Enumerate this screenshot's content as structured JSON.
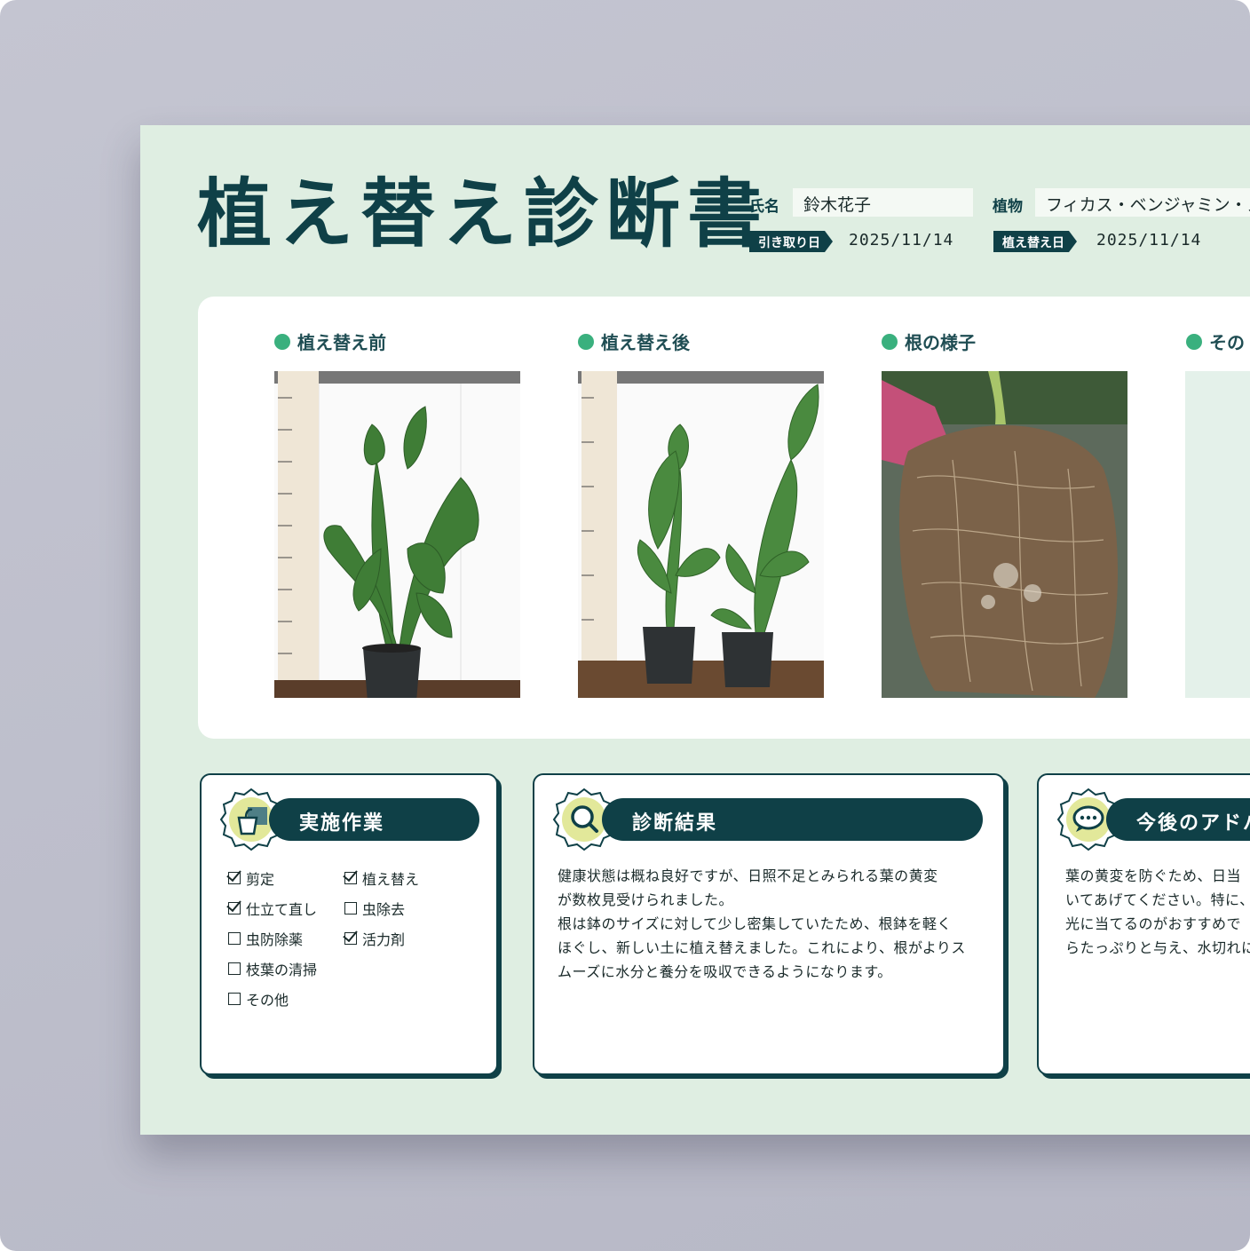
{
  "document": {
    "title": "植え替え診断書",
    "name_label": "氏名",
    "name_value": "鈴木花子",
    "plant_label": "植物",
    "plant_value": "フィカス・ベンジャミン・スタ",
    "pickup_label": "引き取り日",
    "pickup_date": "2025/11/14",
    "repot_label": "植え替え日",
    "repot_date": "2025/11/14"
  },
  "photos": [
    {
      "label": "植え替え前"
    },
    {
      "label": "植え替え後"
    },
    {
      "label": "根の様子"
    },
    {
      "label": "その"
    }
  ],
  "work": {
    "title": "実施作業",
    "items": [
      {
        "label": "剪定",
        "checked": true
      },
      {
        "label": "植え替え",
        "checked": true
      },
      {
        "label": "仕立て直し",
        "checked": true
      },
      {
        "label": "虫除去",
        "checked": false
      },
      {
        "label": "虫防除薬",
        "checked": false
      },
      {
        "label": "活力剤",
        "checked": true
      },
      {
        "label": "枝葉の清掃",
        "checked": false
      },
      {
        "label": "その他",
        "checked": false
      }
    ]
  },
  "diagnosis": {
    "title": "診断結果",
    "lines": [
      "健康状態は概ね良好ですが、日照不足とみられる葉の黄変",
      "が数枚見受けられました。",
      "根は鉢のサイズに対して少し密集していたため、根鉢を軽く",
      "ほぐし、新しい土に植え替えました。これにより、根がよりス",
      "ムーズに水分と養分を吸収できるようになります。"
    ]
  },
  "advice": {
    "title": "今後のアドバ",
    "lines": [
      "葉の黄変を防ぐため、日当",
      "いてあげてください。特に、",
      "光に当てるのがおすすめで",
      "らたっぷりと与え、水切れに"
    ]
  },
  "colors": {
    "primary": "#0f4047",
    "background": "#dfeee2",
    "accent_dot": "#3ab07e",
    "badge": "#e2e89a"
  }
}
